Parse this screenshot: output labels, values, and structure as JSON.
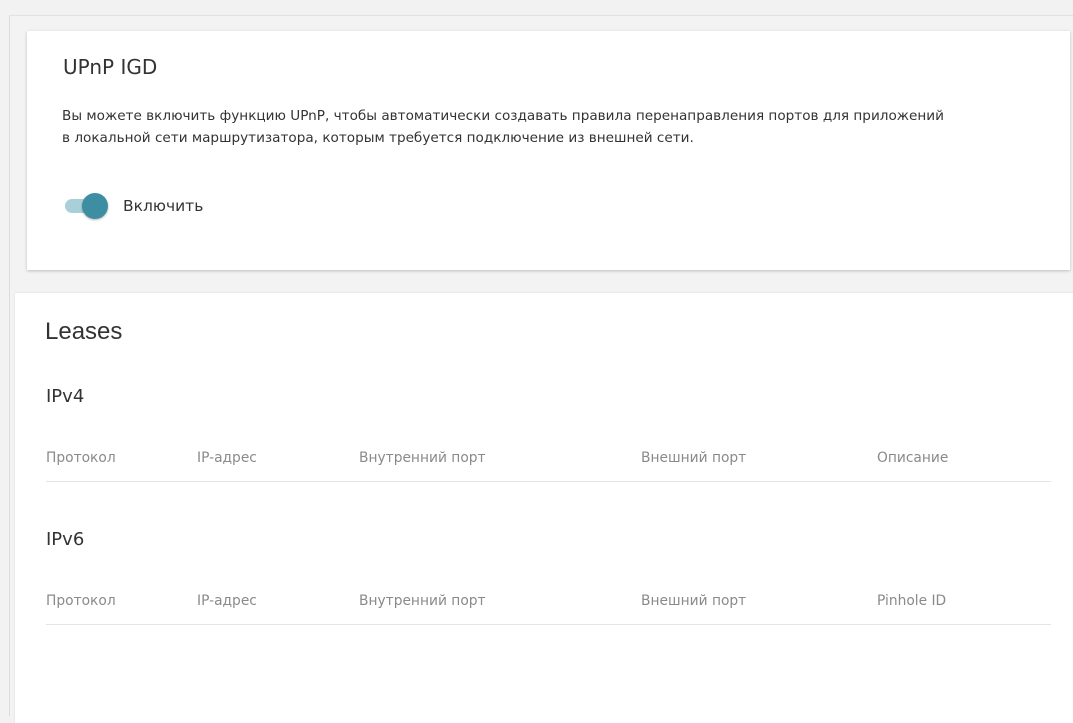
{
  "upnp": {
    "title": "UPnP IGD",
    "description_line1": "Вы можете включить функцию UPnP, чтобы автоматически создавать правила перенаправления портов для приложений",
    "description_line2": "в локальной сети маршрутизатора, которым требуется подключение из внешней сети.",
    "toggle": {
      "label": "Включить",
      "enabled": true
    }
  },
  "leases": {
    "title": "Leases",
    "ipv4": {
      "title": "IPv4",
      "columns": [
        "Протокол",
        "IP-адрес",
        "Внутренний порт",
        "Внешний порт",
        "Описание"
      ],
      "rows": []
    },
    "ipv6": {
      "title": "IPv6",
      "columns": [
        "Протокол",
        "IP-адрес",
        "Внутренний порт",
        "Внешний порт",
        "Pinhole ID"
      ],
      "rows": []
    }
  },
  "colors": {
    "toggle_track": "#a9d0d8",
    "toggle_knob": "#3e8ea3",
    "header_text": "#8a8a8a",
    "background": "#f3f3f3"
  }
}
